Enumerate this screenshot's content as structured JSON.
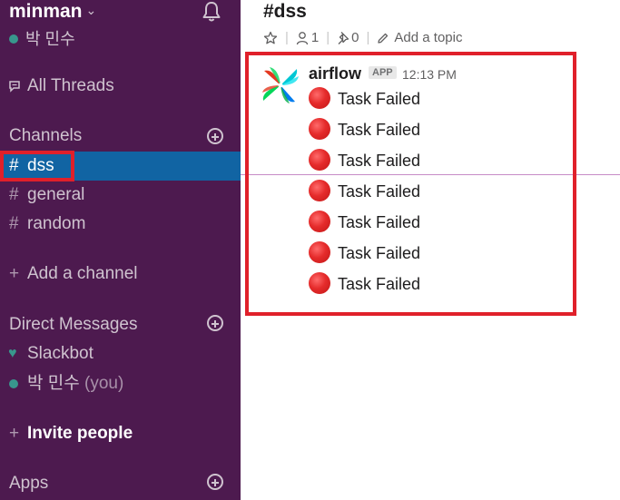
{
  "workspace": {
    "name": "minman",
    "user": "박 민수"
  },
  "sidebar": {
    "all_threads": "All Threads",
    "channels_header": "Channels",
    "channels": [
      {
        "label": "dss",
        "active": true
      },
      {
        "label": "general",
        "active": false
      },
      {
        "label": "random",
        "active": false
      }
    ],
    "add_channel": "Add a channel",
    "dm_header": "Direct Messages",
    "dms": [
      {
        "label": "Slackbot"
      },
      {
        "label": "박 민수",
        "suffix": "(you)"
      }
    ],
    "invite": "Invite people",
    "apps": "Apps",
    "icons": {
      "hash": "#",
      "plus": "+"
    }
  },
  "channel": {
    "title": "#dss",
    "members": "1",
    "pins": "0",
    "add_topic": "Add a topic"
  },
  "message": {
    "sender": "airflow",
    "badge": "APP",
    "time": "12:13 PM",
    "lines": [
      "Task Failed",
      "Task Failed",
      "Task Failed",
      "Task Failed",
      "Task Failed",
      "Task Failed",
      "Task Failed"
    ]
  },
  "colors": {
    "sidebar_bg": "#4d1a4f",
    "active": "#1164a3",
    "highlight": "#e0202a",
    "presence": "#38978d"
  }
}
